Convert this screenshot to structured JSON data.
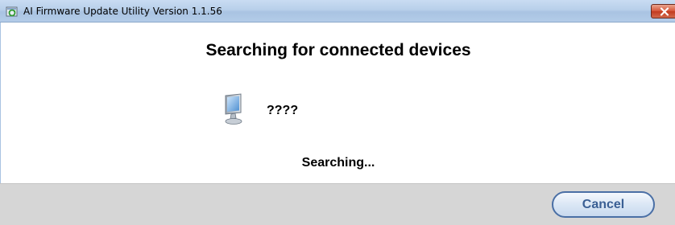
{
  "window": {
    "title": "AI Firmware Update Utility Version 1.1.56",
    "close_icon": "close-icon",
    "app_icon": "app-refresh-icon"
  },
  "main": {
    "heading": "Searching for connected devices",
    "device": {
      "icon": "computer-monitor-icon",
      "name": "????"
    },
    "status": "Searching..."
  },
  "footer": {
    "cancel_label": "Cancel"
  },
  "colors": {
    "titlebar": "#b8cfea",
    "close_button": "#c23b1f",
    "footer_background": "#d6d6d6",
    "button_text": "#3a5f94",
    "button_border": "#4a6fa5"
  }
}
